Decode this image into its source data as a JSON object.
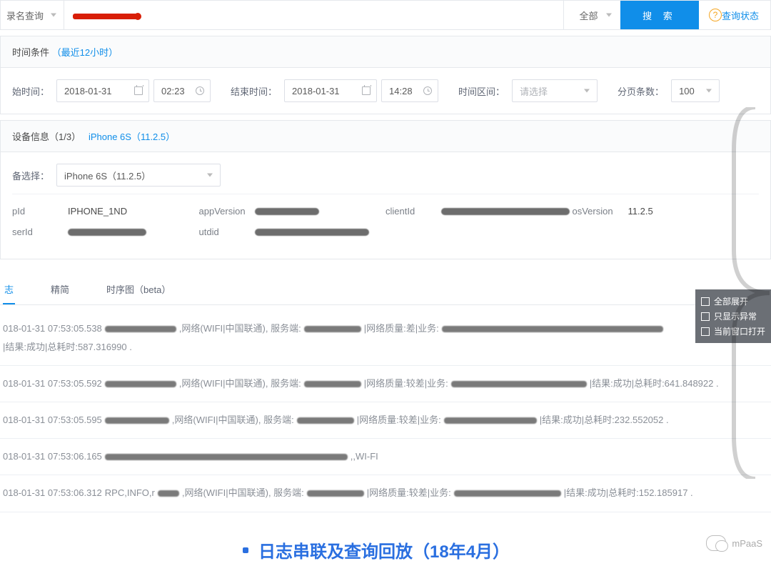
{
  "topbar": {
    "query_type_label": "录名查询",
    "all_label": "全部",
    "search_label": "搜 索",
    "status_link": "查询状态"
  },
  "time": {
    "header_label": "时间条件",
    "header_hint": "（最近12小时）",
    "start_label": "始时间：",
    "start_date": "2018-01-31",
    "start_time": "02:23",
    "end_label": "结束时间：",
    "end_date": "2018-01-31",
    "end_time": "14:28",
    "range_label": "时间区间：",
    "range_placeholder": "请选择",
    "page_label": "分页条数：",
    "page_value": "100"
  },
  "device": {
    "header_label": "设备信息（1/3）",
    "header_hint": "iPhone 6S（11.2.5）",
    "select_label": "备选择：",
    "select_value": "iPhone 6S（11.2.5）",
    "props": {
      "pid_label": "pId",
      "pid_value": "IPHONE_1ND",
      "appversion_label": "appVersion",
      "clientid_label": "clientId",
      "osversion_label": "osVersion",
      "osversion_value": "11.2.5",
      "userid_label": "serId",
      "utdid_label": "utdid"
    }
  },
  "tabs": {
    "t1": "志",
    "t2": "精简",
    "t3": "时序图（beta）"
  },
  "logs": [
    {
      "ts": "018-01-31 07:53:05.538",
      "net": ",网络(WIFI|中国联通), 服务端:",
      "mid": "|网络质量:差|业务:",
      "tail": "|结果:成功|总耗时:587.316990 ."
    },
    {
      "ts": "018-01-31 07:53:05.592",
      "net": ",网络(WIFI|中国联通), 服务端:",
      "mid": "|网络质量:较差|业务:",
      "tail": "|结果:成功|总耗时:641.848922 ."
    },
    {
      "ts": "018-01-31 07:53:05.595",
      "net": ",网络(WIFI|中国联通), 服务端:",
      "mid": "|网络质量:较差|业务:",
      "tail": "|结果:成功|总耗时:232.552052 ."
    },
    {
      "ts": "018-01-31 07:53:06.165",
      "wifi": ",,WI-FI"
    },
    {
      "ts": "018-01-31 07:53:06.312",
      "prefix": " RPC,INFO,r",
      "net": ",网络(WIFI|中国联通), 服务端:",
      "mid": "|网络质量:较差|业务:",
      "tail": "|结果:成功|总耗时:152.185917 ."
    }
  ],
  "side": {
    "o1": "全部展开",
    "o2": "只显示异常",
    "o3": "当前窗口打开"
  },
  "caption": "日志串联及查询回放（18年4月）",
  "wechat": "mPaaS"
}
